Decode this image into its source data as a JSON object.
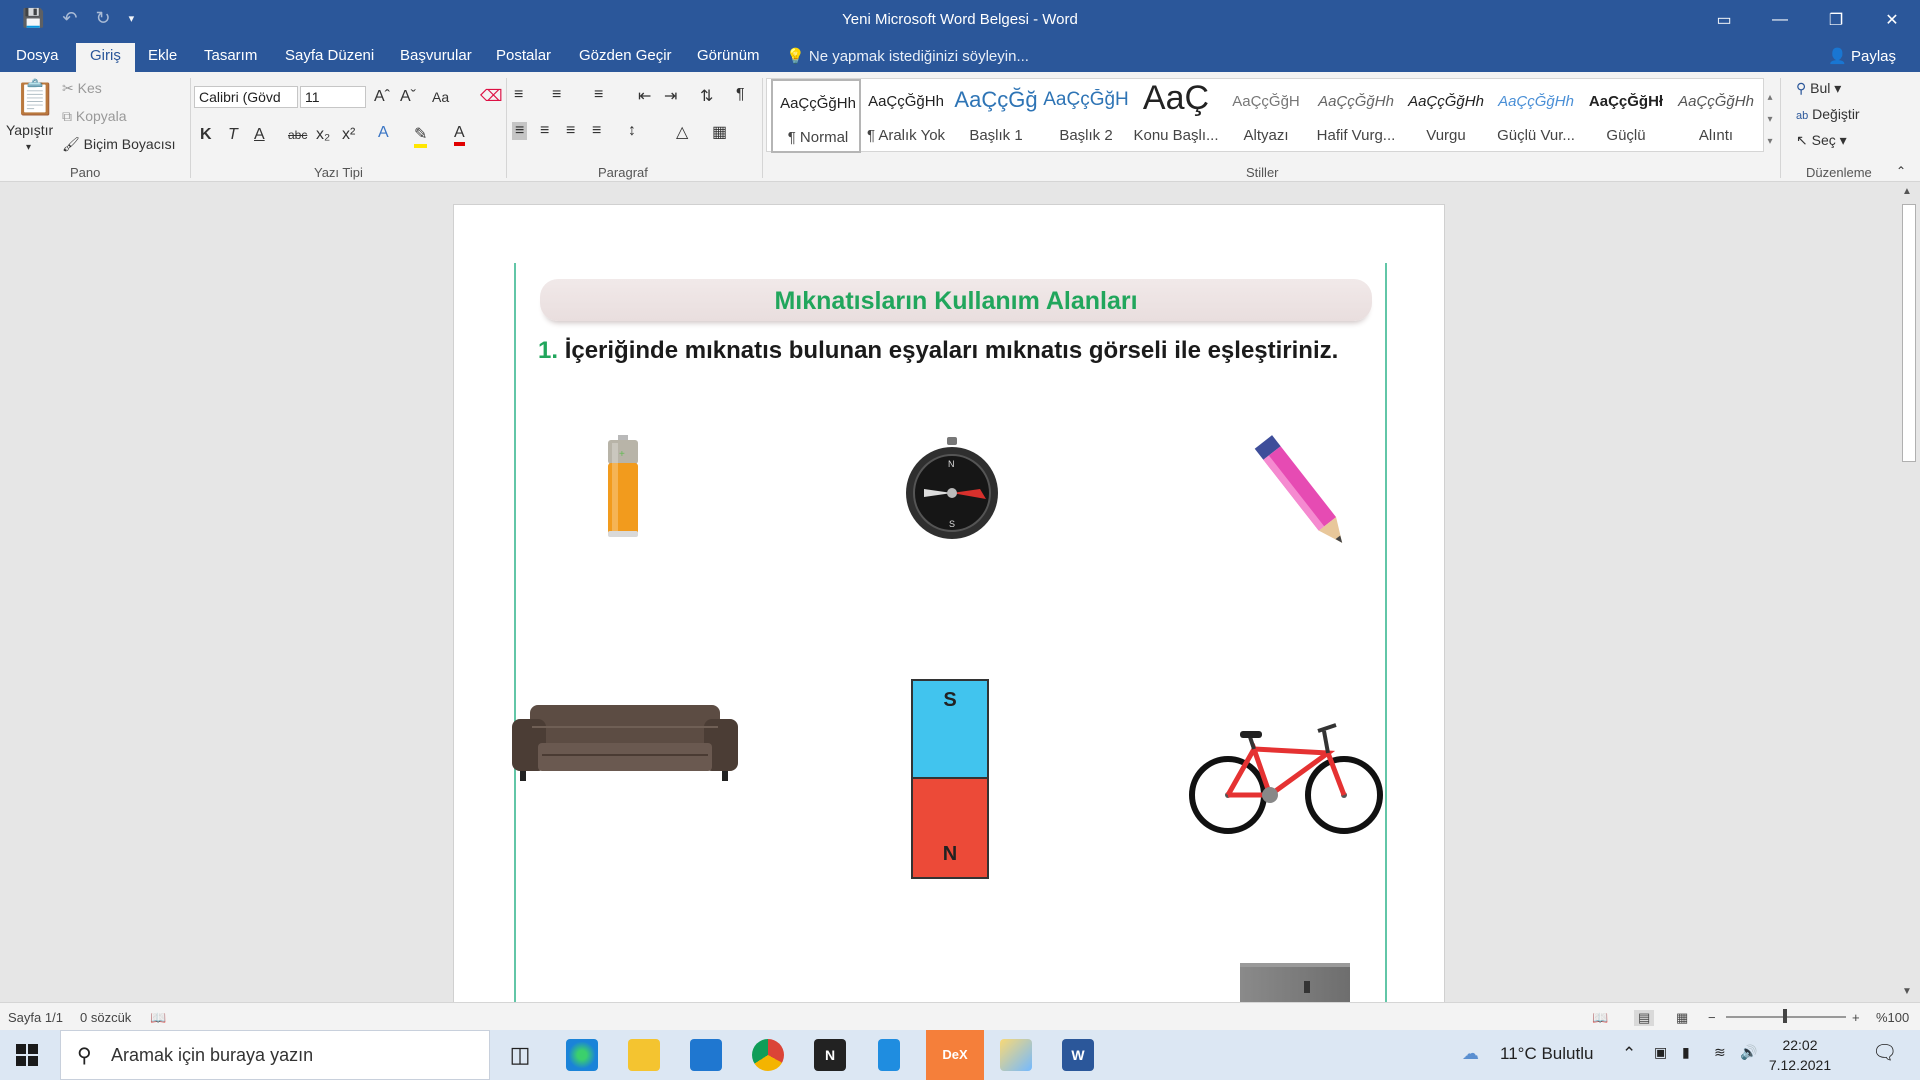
{
  "window": {
    "title": "Yeni Microsoft Word Belgesi - Word"
  },
  "menu": {
    "tabs": [
      "Dosya",
      "Giriş",
      "Ekle",
      "Tasarım",
      "Sayfa Düzeni",
      "Başvurular",
      "Postalar",
      "Gözden Geçir",
      "Görünüm"
    ],
    "active": "Giriş",
    "tell_me": "Ne yapmak istediğinizi söyleyin...",
    "share": "Paylaş"
  },
  "ribbon": {
    "pano": {
      "label": "Pano",
      "paste": "Yapıştır",
      "cut": "Kes",
      "copy": "Kopyala",
      "format_painter": "Biçim Boyacısı"
    },
    "font": {
      "label": "Yazı Tipi",
      "family": "Calibri (Gövd",
      "size": "11",
      "bold": "K",
      "italic": "T",
      "underline": "A",
      "strike": "abc",
      "sub": "x₂",
      "sup": "x²",
      "case": "Aa"
    },
    "paragraph": {
      "label": "Paragraf"
    },
    "styles": {
      "label": "Stiller",
      "items": [
        {
          "preview": "AaÇçĞğHh",
          "name": "¶ Normal"
        },
        {
          "preview": "AaÇçĞğHh",
          "name": "¶ Aralık Yok"
        },
        {
          "preview": "AaÇçĞğ",
          "name": "Başlık 1"
        },
        {
          "preview": "AaÇçĞğH",
          "name": "Başlık 2"
        },
        {
          "preview": "AaÇ",
          "name": "Konu Başlı..."
        },
        {
          "preview": "AaÇçĞğH",
          "name": "Altyazı"
        },
        {
          "preview": "AaÇçĞğHh",
          "name": "Hafif Vurg..."
        },
        {
          "preview": "AaÇçĞğHh",
          "name": "Vurgu"
        },
        {
          "preview": "AaÇçĞğHh",
          "name": "Güçlü Vur..."
        },
        {
          "preview": "AaÇçĞğHł",
          "name": "Güçlü"
        },
        {
          "preview": "AaÇçĞğHh",
          "name": "Alıntı"
        }
      ]
    },
    "editing": {
      "label": "Düzenleme",
      "find": "Bul",
      "replace": "Değiştir",
      "select": "Seç"
    }
  },
  "document": {
    "banner": "Mıknatısların Kullanım Alanları",
    "question_number": "1.",
    "question": "İçeriğinde mıknatıs bulunan eşyaları mıknatıs görseli ile eşleştiriniz.",
    "magnet_top": "S",
    "magnet_bottom": "N",
    "compass_n": "N",
    "compass_s": "S"
  },
  "status": {
    "page": "Sayfa 1/1",
    "words": "0 sözcük",
    "zoom": "%100"
  },
  "taskbar": {
    "search_placeholder": "Aramak için buraya yazın",
    "weather": "11°C  Bulutlu",
    "time": "22:02",
    "date": "7.12.2021",
    "app_dex": "DeX"
  },
  "colors": {
    "word_blue": "#2b579a",
    "banner_green": "#21a65c",
    "magnet_blue": "#41c4ee",
    "magnet_red": "#ec4a38"
  }
}
